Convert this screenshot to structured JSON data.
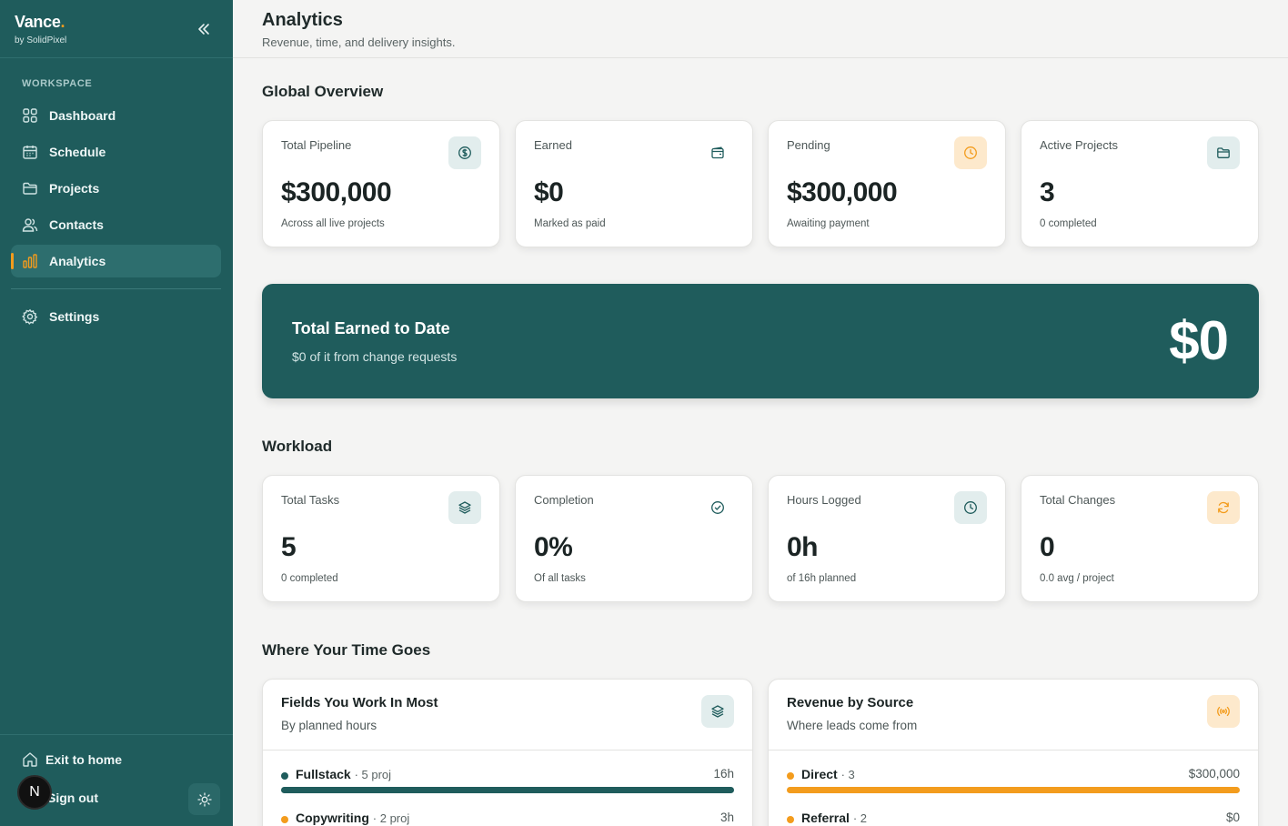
{
  "app": {
    "name": "Vance",
    "dot": ".",
    "by": "by SolidPixel"
  },
  "sidebar": {
    "section_label": "WORKSPACE",
    "items": [
      {
        "label": "Dashboard",
        "icon": "grid-icon"
      },
      {
        "label": "Schedule",
        "icon": "calendar-icon"
      },
      {
        "label": "Projects",
        "icon": "folder-icon"
      },
      {
        "label": "Contacts",
        "icon": "users-icon"
      },
      {
        "label": "Analytics",
        "icon": "bar-chart-icon",
        "active": true
      }
    ],
    "settings_label": "Settings",
    "exit_label": "Exit to home",
    "signout_label": "Sign out",
    "avatar_initial": "N"
  },
  "header": {
    "title": "Analytics",
    "subtitle": "Revenue, time, and delivery insights."
  },
  "overview": {
    "title": "Global Overview",
    "cards": [
      {
        "label": "Total Pipeline",
        "value": "$300,000",
        "note": "Across all live projects",
        "icon": "dollar-icon"
      },
      {
        "label": "Earned",
        "value": "$0",
        "note": "Marked as paid",
        "icon": "wallet-icon"
      },
      {
        "label": "Pending",
        "value": "$300,000",
        "note": "Awaiting payment",
        "icon": "clock-icon"
      },
      {
        "label": "Active Projects",
        "value": "3",
        "note": "0 completed",
        "icon": "folder-icon"
      }
    ]
  },
  "banner": {
    "title": "Total Earned to Date",
    "subtitle": "$0 of it from change requests",
    "value": "$0"
  },
  "workload": {
    "title": "Workload",
    "cards": [
      {
        "label": "Total Tasks",
        "value": "5",
        "note": "0 completed",
        "icon": "layers-icon"
      },
      {
        "label": "Completion",
        "value": "0%",
        "note": "Of all tasks",
        "icon": "check-circle-icon"
      },
      {
        "label": "Hours Logged",
        "value": "0h",
        "note": "of 16h planned",
        "icon": "clock-icon"
      },
      {
        "label": "Total Changes",
        "value": "0",
        "note": "0.0 avg / project",
        "icon": "refresh-icon"
      }
    ]
  },
  "time": {
    "title": "Where Your Time Goes",
    "fields": {
      "title": "Fields You Work In Most",
      "subtitle": "By planned hours",
      "rows": [
        {
          "name": "Fullstack",
          "meta": "· 5 proj",
          "value": "16h",
          "fraction": 1.0
        },
        {
          "name": "Copywriting",
          "meta": "· 2 proj",
          "value": "3h",
          "fraction": 0.19
        }
      ]
    },
    "revenue": {
      "title": "Revenue by Source",
      "subtitle": "Where leads come from",
      "rows": [
        {
          "name": "Direct",
          "meta": "· 3",
          "value": "$300,000",
          "fraction": 1.0
        },
        {
          "name": "Referral",
          "meta": "· 2",
          "value": "$0",
          "fraction": 0.0
        }
      ]
    }
  },
  "colors": {
    "primary": "#1f5c5c",
    "accent": "#f39c1d",
    "background": "#f4f4f3"
  }
}
